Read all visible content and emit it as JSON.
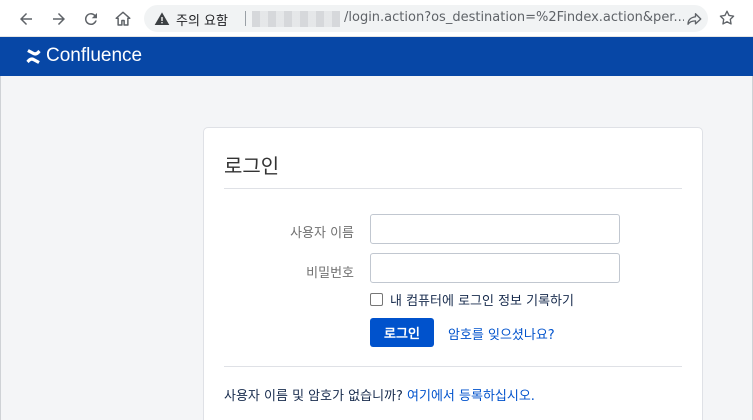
{
  "browser": {
    "security_warning": "주의 요함",
    "url": "/login.action?os_destination=%2Findex.action&per...",
    "icons": [
      "back-icon",
      "forward-icon",
      "reload-icon",
      "home-icon",
      "warning-icon",
      "share-icon",
      "star-icon"
    ]
  },
  "header": {
    "app_name": "Confluence",
    "bg_color": "#0747a6"
  },
  "login": {
    "title": "로그인",
    "username_label": "사용자 이름",
    "password_label": "비밀번호",
    "username_value": "",
    "password_value": "",
    "remember_label": "내 컴퓨터에 로그인 정보 기록하기",
    "remember_checked": false,
    "submit_label": "로그인",
    "forgot_link": "암호를 잊으셨나요?",
    "no_account_text": "사용자 이름 및 암호가 없습니까? ",
    "signup_link": "여기에서 등록하십시오."
  },
  "colors": {
    "primary": "#0052cc",
    "link": "#0052cc"
  }
}
